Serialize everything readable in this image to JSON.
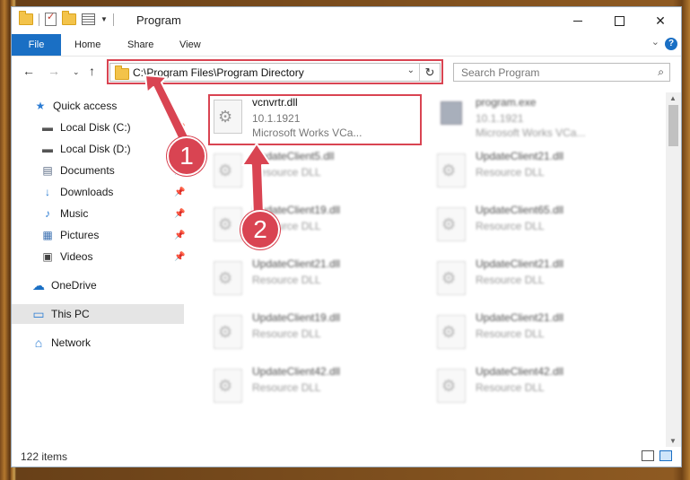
{
  "window": {
    "title": "Program",
    "controls": {
      "minimize": "",
      "maximize": "",
      "close": "✕"
    }
  },
  "ribbon": {
    "tabs": [
      "File",
      "Home",
      "Share",
      "View"
    ],
    "expand": "⌄",
    "help": "?"
  },
  "address": {
    "path": "C:\\Program Files\\Program Directory",
    "dropdown": "⌄",
    "refresh": "↻"
  },
  "search": {
    "placeholder": "Search Program",
    "icon": "⌕"
  },
  "nav": {
    "back": "←",
    "forward": "→",
    "recent": "⌄",
    "up": "↑",
    "items": [
      {
        "label": "Quick access",
        "icon": "star-icon",
        "glyph": "★",
        "color": "#2b7cd3"
      },
      {
        "label": "Local Disk (C:)",
        "icon": "drive-icon",
        "glyph": "▬",
        "color": "#555555"
      },
      {
        "label": "Local Disk (D:)",
        "icon": "drive-icon",
        "glyph": "▬",
        "color": "#555555"
      },
      {
        "label": "Documents",
        "icon": "documents-icon",
        "glyph": "▤",
        "color": "#5a6b84"
      },
      {
        "label": "Downloads",
        "icon": "download-icon",
        "glyph": "↓",
        "color": "#2b7cd3"
      },
      {
        "label": "Music",
        "icon": "music-icon",
        "glyph": "♪",
        "color": "#2b7cd3"
      },
      {
        "label": "Pictures",
        "icon": "pictures-icon",
        "glyph": "▦",
        "color": "#3a6fb0"
      },
      {
        "label": "Videos",
        "icon": "videos-icon",
        "glyph": "▣",
        "color": "#444444"
      },
      {
        "label": "OneDrive",
        "icon": "cloud-icon",
        "glyph": "☁",
        "color": "#1a6fc4"
      },
      {
        "label": "This PC",
        "icon": "computer-icon",
        "glyph": "▭",
        "color": "#2b7cd3"
      },
      {
        "label": "Network",
        "icon": "network-icon",
        "glyph": "⌂",
        "color": "#2b7cd3"
      }
    ],
    "pin": "📌"
  },
  "files": [
    {
      "name": "vcnvrtr.dll",
      "line1": "10.1.1921",
      "line2": "Microsoft Works VCa..."
    },
    {
      "name": "program.exe",
      "line1": "10.1.1921",
      "line2": "Microsoft Works VCa..."
    },
    {
      "name": "UpdateClient5.dll",
      "line1": "Resource DLL",
      "line2": ""
    },
    {
      "name": "UpdateClient21.dll",
      "line1": "Resource DLL",
      "line2": ""
    },
    {
      "name": "UpdateClient19.dll",
      "line1": "Resource DLL",
      "line2": ""
    },
    {
      "name": "UpdateClient65.dll",
      "line1": "Resource DLL",
      "line2": ""
    },
    {
      "name": "UpdateClient21.dll",
      "line1": "Resource DLL",
      "line2": ""
    },
    {
      "name": "UpdateClient21.dll",
      "line1": "Resource DLL",
      "line2": ""
    },
    {
      "name": "UpdateClient19.dll",
      "line1": "Resource DLL",
      "line2": ""
    },
    {
      "name": "UpdateClient21.dll",
      "line1": "Resource DLL",
      "line2": ""
    },
    {
      "name": "UpdateClient42.dll",
      "line1": "Resource DLL",
      "line2": ""
    },
    {
      "name": "UpdateClient42.dll",
      "line1": "Resource DLL",
      "line2": ""
    }
  ],
  "status": {
    "count": "122 items"
  },
  "annotations": {
    "step1": "1",
    "step2": "2",
    "color": "#d94452"
  }
}
